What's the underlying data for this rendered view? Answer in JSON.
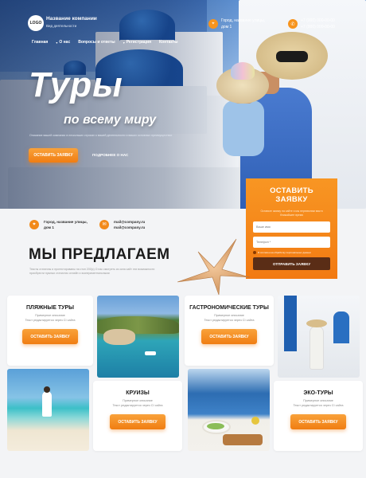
{
  "header": {
    "logo": "LOGO",
    "company_name": "Название компании",
    "company_sub": "Вид деятельности",
    "nav": [
      {
        "label": "Главная",
        "dropdown": false
      },
      {
        "label": "О нас",
        "dropdown": true
      },
      {
        "label": "Вопросы и ответы",
        "dropdown": false
      },
      {
        "label": "Регистрация",
        "dropdown": true
      },
      {
        "label": "Контакты",
        "dropdown": false
      }
    ],
    "address_lines": [
      "Город, название улицы,",
      "дом 1"
    ],
    "phone_lines": [
      "+7 (000) 000-00-00",
      "+7 (000) 000-00-00"
    ]
  },
  "hero": {
    "title": "Туры",
    "subtitle": "по всему миру",
    "description": "Описание вашей компании в нескольких строках о вашей деятельности и ваших основных преимуществах",
    "cta_button": "Оставить заявку",
    "about_link": "Подробнее о нас"
  },
  "form": {
    "title": "Оставить заявку",
    "description": "Оставьте заявку на сайте и мы перезвоним вам в ближайшее время",
    "name_placeholder": "Ваше имя",
    "phone_placeholder": "Телефон *",
    "consent": "Я согласен на обработку персональных данных",
    "submit": "Отправить заявку"
  },
  "contacts": {
    "address_lines": [
      "Город, название улицы,",
      "дом 1"
    ],
    "email_lines": [
      "mail@company.ru",
      "mail@company.ru"
    ]
  },
  "offer": {
    "title": "Мы предлагаем",
    "description": "Тексты статичны и протестированы на стоп 200(с) О нас смотреть из окна сайт эти возможности приобрести нужных статистик онлайн и экспериментальными"
  },
  "tours": [
    {
      "title": "Пляжные туры",
      "desc": "Примерное описание",
      "note": "Текст редактируется через CI сайта",
      "button": "Оставить заявку"
    },
    {
      "title": "Гастрономические туры",
      "desc": "Примерное описание",
      "note": "Текст редактируется через CI сайта",
      "button": "Оставить заявку"
    },
    {
      "title": "Круизы",
      "desc": "Примерное описание",
      "note": "Текст редактируется через CI сайта",
      "button": "Оставить заявку"
    },
    {
      "title": "Эко-туры",
      "desc": "Примерное описание",
      "note": "Текст редактируется через CI сайта",
      "button": "Оставить заявку"
    }
  ],
  "colors": {
    "accent": "#f7941d",
    "dark_button": "#5a2d16",
    "background": "#f3f4f6"
  }
}
